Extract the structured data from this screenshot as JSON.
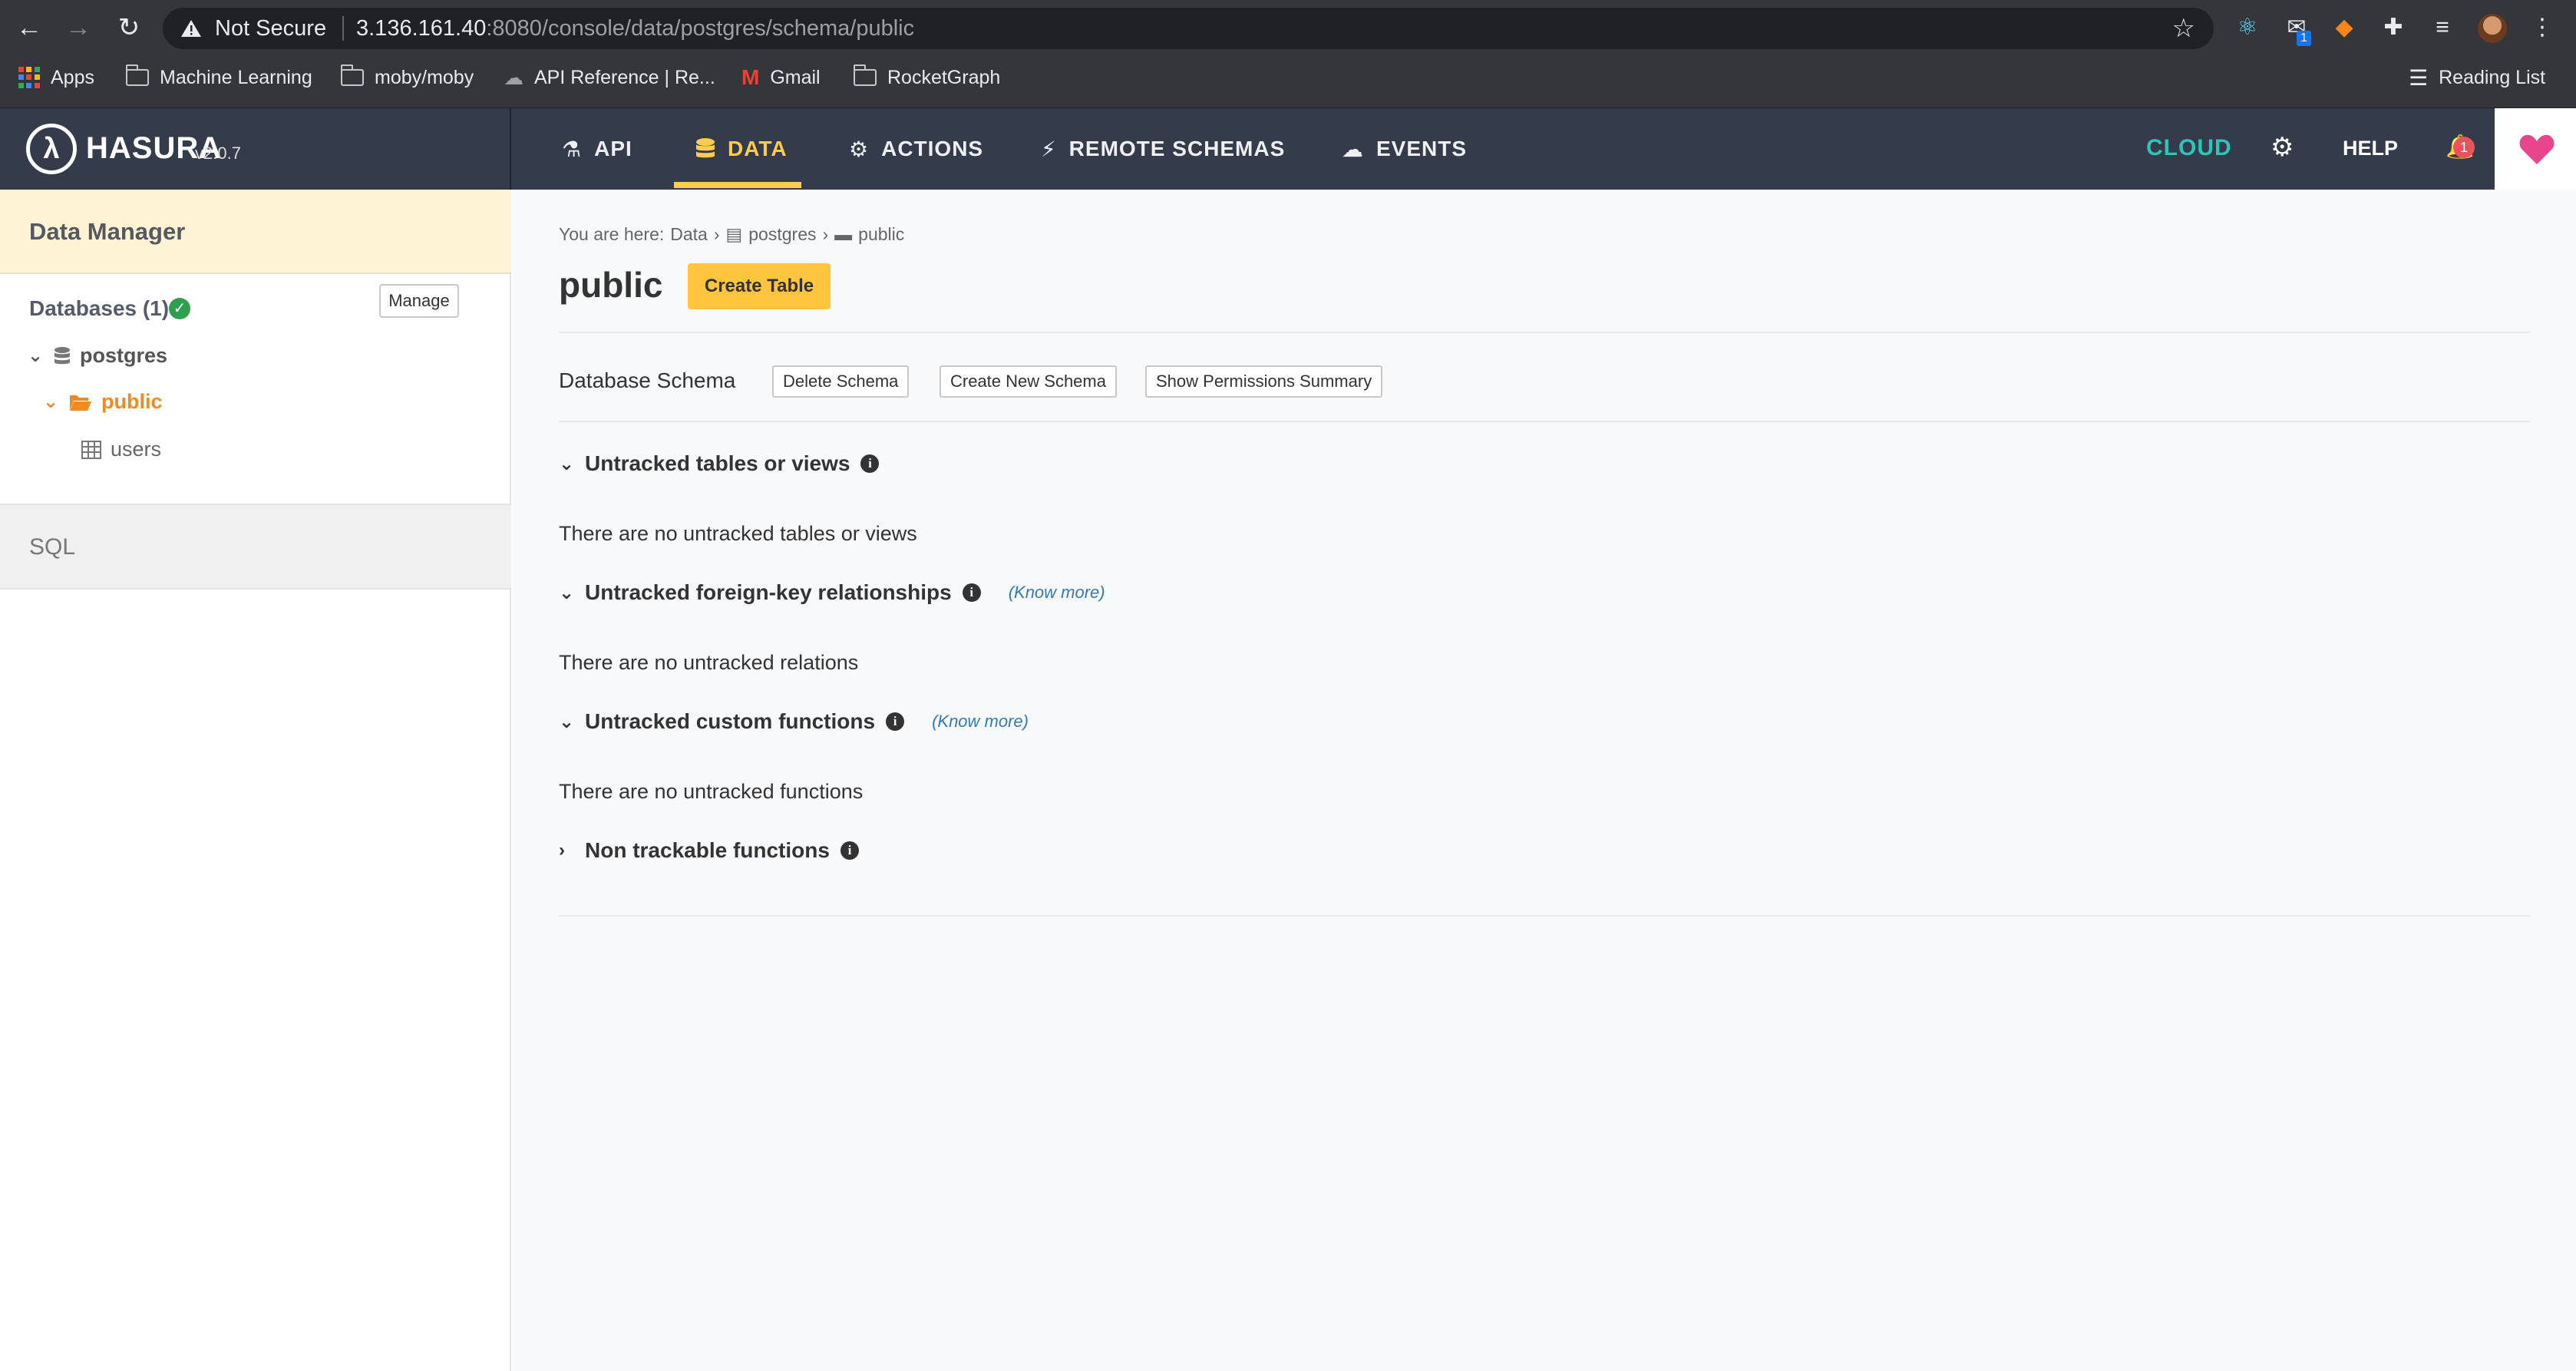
{
  "browser": {
    "security_label": "Not Secure",
    "url_host": "3.136.161.40",
    "url_rest": ":8080/console/data/postgres/schema/public",
    "extension_badge": "1",
    "bookmarks": [
      {
        "label": "Apps"
      },
      {
        "label": "Machine Learning"
      },
      {
        "label": "moby/moby"
      },
      {
        "label": "API Reference | Re..."
      },
      {
        "label": "Gmail"
      },
      {
        "label": "RocketGraph"
      }
    ],
    "reading_list": "Reading List"
  },
  "header": {
    "brand": "HASURA",
    "version": "v2.0.7",
    "tabs": [
      {
        "label": "API",
        "icon": "flask-icon"
      },
      {
        "label": "DATA",
        "icon": "database-icon",
        "active": true
      },
      {
        "label": "ACTIONS",
        "icon": "cogs-icon"
      },
      {
        "label": "REMOTE SCHEMAS",
        "icon": "plug-icon"
      },
      {
        "label": "EVENTS",
        "icon": "cloud-icon"
      }
    ],
    "cloud": "CLOUD",
    "help": "HELP",
    "notifications": "1",
    "accent": "#ffcd47"
  },
  "sidebar": {
    "title": "Data Manager",
    "databases_heading": "Databases (1)",
    "manage_label": "Manage",
    "tree": {
      "database": "postgres",
      "schema": "public",
      "table": "users"
    },
    "sql_label": "SQL"
  },
  "main": {
    "breadcrumb": {
      "prefix": "You are here:",
      "items": [
        "Data",
        "postgres",
        "public"
      ]
    },
    "title": "public",
    "create_table": "Create Table",
    "schema_label": "Database Schema",
    "schema_buttons": [
      "Delete Schema",
      "Create New Schema",
      "Show Permissions Summary"
    ],
    "know_more": "(Know more)",
    "sections": [
      {
        "title": "Untracked tables or views",
        "empty": "There are no untracked tables or views"
      },
      {
        "title": "Untracked foreign-key relationships",
        "empty": "There are no untracked relations"
      },
      {
        "title": "Untracked custom functions",
        "empty": "There are no untracked functions"
      },
      {
        "title": "Non trackable functions"
      }
    ]
  }
}
